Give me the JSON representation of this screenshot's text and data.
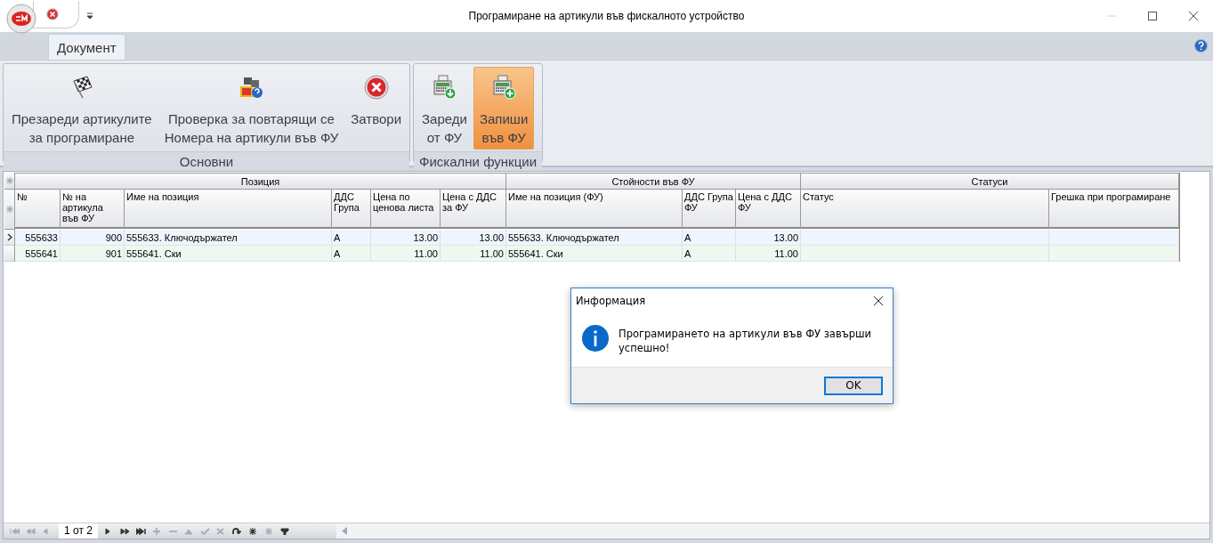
{
  "window": {
    "title": "Програмиране на артикули във фискалното устройство"
  },
  "tabs": [
    {
      "label": "Документ",
      "selected": true
    }
  ],
  "ribbon_groups": [
    {
      "label": "Основни",
      "buttons": [
        {
          "label": "Презареди артикулите\nза програмиране",
          "highlighted": false
        },
        {
          "label": "Проверка за повтарящи се\nНомера на артикули във ФУ",
          "highlighted": false
        },
        {
          "label": "Затвори",
          "highlighted": false
        }
      ]
    },
    {
      "label": "Фискални функции",
      "buttons": [
        {
          "label": "Зареди\nот ФУ",
          "highlighted": false
        },
        {
          "label": "Запиши\nвъв ФУ",
          "highlighted": true
        }
      ]
    }
  ],
  "table": {
    "bands": [
      {
        "label": "Позиция"
      },
      {
        "label": "Стойности във ФУ"
      },
      {
        "label": "Статуси"
      }
    ],
    "columns": [
      {
        "label": "№"
      },
      {
        "label": "№ на артикула във ФУ"
      },
      {
        "label": "Име на позиция"
      },
      {
        "label": "ДДС Група"
      },
      {
        "label": "Цена по ценова листа"
      },
      {
        "label": "Цена с ДДС за ФУ"
      },
      {
        "label": "Име на позиция (ФУ)"
      },
      {
        "label": "ДДС Група ФУ"
      },
      {
        "label": "Цена с ДДС ФУ"
      },
      {
        "label": "Статус"
      },
      {
        "label": "Грешка при програмиране"
      }
    ],
    "rows": [
      {
        "selected": true,
        "cells": [
          "555633",
          "900",
          "555633. Ключодържател",
          "А",
          "13.00",
          "13.00",
          "555633. Ключодържател",
          "А",
          "13.00"
        ]
      },
      {
        "selected": false,
        "cells": [
          "555641",
          "901",
          "555641. Ски",
          "А",
          "11.00",
          "11.00",
          "555641. Ски",
          "А",
          "11.00"
        ]
      }
    ]
  },
  "navigator": {
    "position": "1 от 2",
    "buttons": [
      {
        "kind": "first",
        "disabled": true
      },
      {
        "kind": "prev-page",
        "disabled": true
      },
      {
        "kind": "prev",
        "disabled": true
      },
      {
        "kind": "next",
        "disabled": false
      },
      {
        "kind": "next-page",
        "disabled": false
      },
      {
        "kind": "last",
        "disabled": false
      },
      {
        "kind": "add",
        "disabled": true
      },
      {
        "kind": "remove",
        "disabled": true
      },
      {
        "kind": "edit",
        "disabled": true
      },
      {
        "kind": "accept",
        "disabled": true
      },
      {
        "kind": "cancel",
        "disabled": true
      },
      {
        "kind": "refresh",
        "disabled": false
      },
      {
        "kind": "bookmark",
        "disabled": false
      },
      {
        "kind": "goto-bookmark",
        "disabled": true
      },
      {
        "kind": "filter",
        "disabled": false
      }
    ]
  },
  "dialog": {
    "title": "Информация",
    "message": "Програмирането на артикули във ФУ завърши\nуспешно!",
    "button": "OK"
  }
}
